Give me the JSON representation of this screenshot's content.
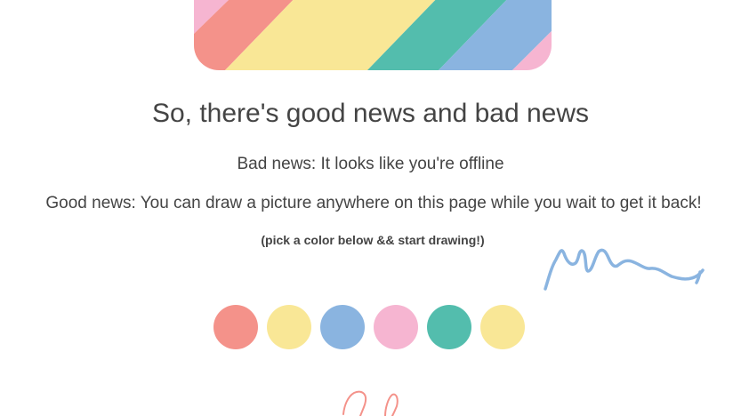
{
  "banner": {
    "stripe_colors": [
      "#f6b5d1",
      "#f4928a",
      "#f9e796",
      "#53bdad",
      "#8ab4e0",
      "#f6b5d1"
    ]
  },
  "content": {
    "headline": "So, there's good news and bad news",
    "bad_news": "Bad news: It looks like you're offline",
    "good_news": "Good news: You can draw a picture anywhere on this page while you wait to get it back!",
    "hint": "(pick a color below && start drawing!)"
  },
  "palette": [
    {
      "name": "red",
      "color": "#f4928a"
    },
    {
      "name": "yellow",
      "color": "#f9e796"
    },
    {
      "name": "blue",
      "color": "#8ab4e0"
    },
    {
      "name": "pink",
      "color": "#f6b5d1"
    },
    {
      "name": "teal",
      "color": "#53bdad"
    },
    {
      "name": "yellow",
      "color": "#f9e796"
    }
  ],
  "drawing": {
    "strokes": [
      {
        "color": "#8ab4e0"
      },
      {
        "color": "#f4928a"
      }
    ]
  }
}
